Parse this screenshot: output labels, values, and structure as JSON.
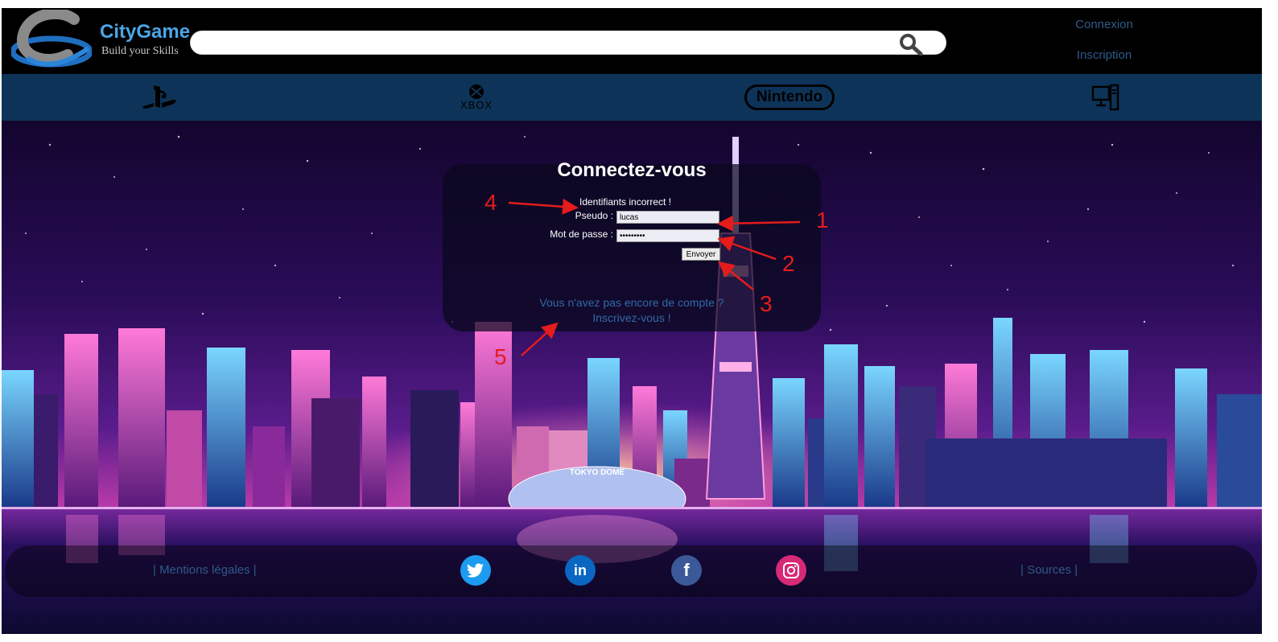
{
  "header": {
    "brand_name": "CityGame",
    "brand_tagline": "Build your Skills",
    "search": {
      "value": "",
      "placeholder": ""
    },
    "login_link": "Connexion",
    "signup_link": "Inscription"
  },
  "platforms": [
    {
      "name": "playstation-icon"
    },
    {
      "name": "xbox-icon",
      "label": "XBOX"
    },
    {
      "name": "nintendo-icon",
      "label": "Nintendo"
    },
    {
      "name": "pc-icon"
    }
  ],
  "scene": {
    "dome_sign": "TOKYO DOME"
  },
  "login": {
    "title": "Connectez-vous",
    "error": "Identifiants incorrect !",
    "username_label": "Pseudo :",
    "username_value": "lucas",
    "password_label": "Mot de passe :",
    "password_value": "•••••••••",
    "submit_label": "Envoyer",
    "no_account_text": "Vous n'avez pas encore de compte ?",
    "signup_link": "Inscrivez-vous !"
  },
  "annotations": [
    "1",
    "2",
    "3",
    "4",
    "5"
  ],
  "footer": {
    "legal_link": "| Mentions légales |",
    "sources_link": "| Sources |",
    "social": [
      {
        "name": "twitter-icon"
      },
      {
        "name": "linkedin-icon",
        "label": "in"
      },
      {
        "name": "facebook-icon",
        "label": "f"
      },
      {
        "name": "instagram-icon"
      }
    ]
  },
  "colors": {
    "header_bg": "#000000",
    "platform_bar_bg": "#0d3458",
    "link": "#2f5a8a",
    "brand": "#4aa6e8",
    "annotation": "#e41c1c",
    "twitter": "#1d9bf0",
    "linkedin": "#0a66c2",
    "facebook": "#3b5998",
    "instagram": "#d62976"
  }
}
